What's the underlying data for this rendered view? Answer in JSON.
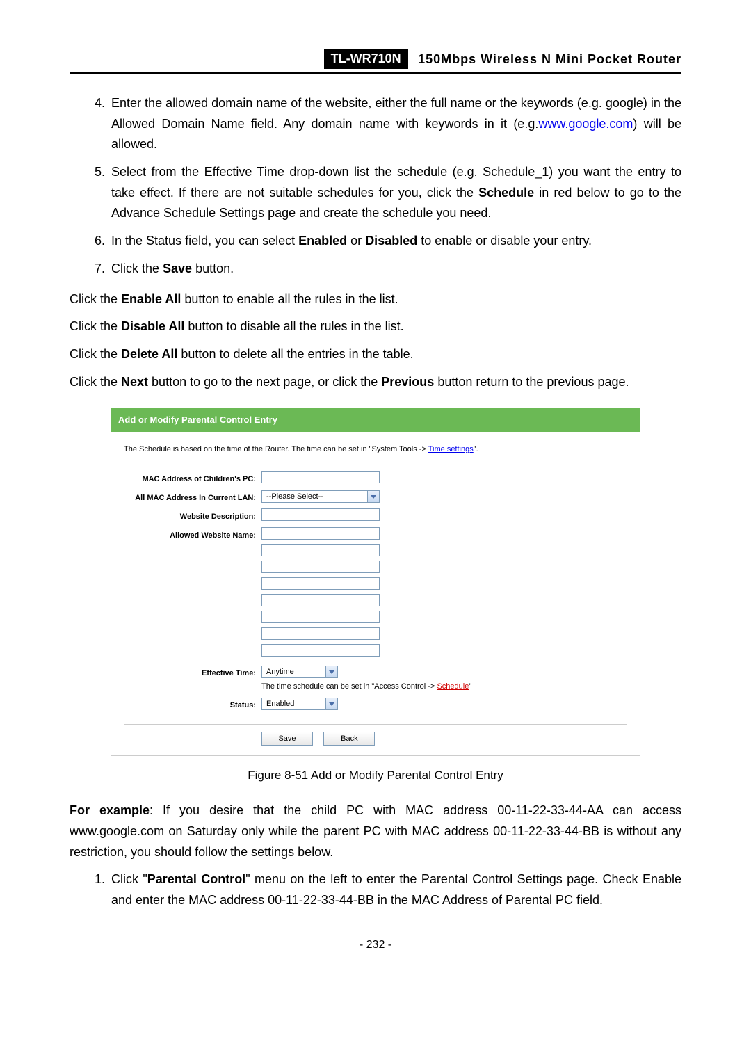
{
  "header": {
    "model": "TL-WR710N",
    "title": "150Mbps  Wireless  N  Mini  Pocket  Router"
  },
  "steps": {
    "s4_a": "Enter the allowed domain name of the website, either the full name or the keywords (e.g. google) in the Allowed Domain Name field. Any domain name with keywords in it (e.g.",
    "s4_link": "www.google.com",
    "s4_b": ") will be allowed.",
    "s5_a": "Select from the Effective Time drop-down list the schedule (e.g. Schedule_1) you want the entry to take effect. If there are not suitable schedules for you, click the ",
    "s5_bold": "Schedule",
    "s5_b": " in red below to go to the Advance Schedule Settings page and create the schedule you need.",
    "s6_a": "In the Status field, you can select ",
    "s6_bold1": "Enabled",
    "s6_mid": " or ",
    "s6_bold2": "Disabled",
    "s6_b": " to enable or disable your entry.",
    "s7_a": "Click the ",
    "s7_bold": "Save",
    "s7_b": " button."
  },
  "paras": {
    "p1_a": "Click the ",
    "p1_bold": "Enable All",
    "p1_b": " button to enable all the rules in the list.",
    "p2_a": "Click the ",
    "p2_bold": "Disable All",
    "p2_b": " button to disable all the rules in the list.",
    "p3_a": "Click the ",
    "p3_bold": "Delete All",
    "p3_b": " button to delete all the entries in the table.",
    "p4_a": "Click the ",
    "p4_bold1": "Next",
    "p4_mid": " button to go to the next page, or click the ",
    "p4_bold2": "Previous",
    "p4_b": " button return to the previous page."
  },
  "figure": {
    "title": "Add or Modify Parental Control Entry",
    "note_a": "The Schedule is based on the time of the Router. The time can be set in \"System Tools -> ",
    "note_link": "Time settings",
    "note_b": "\".",
    "labels": {
      "mac_child": "MAC Address of Children's PC:",
      "all_mac": "All MAC Address In Current LAN:",
      "web_desc": "Website Description:",
      "allowed_name": "Allowed Website Name:",
      "eff_time": "Effective Time:",
      "status": "Status:"
    },
    "values": {
      "please_select": "--Please Select--",
      "anytime": "Anytime",
      "enabled": "Enabled"
    },
    "eff_note_a": "The time schedule can be set in \"Access Control -> ",
    "eff_note_link": "Schedule",
    "eff_note_b": "\"",
    "buttons": {
      "save": "Save",
      "back": "Back"
    },
    "caption": "Figure 8-51    Add or Modify Parental Control Entry"
  },
  "example": {
    "lead_bold": "For example",
    "lead_rest": ": If you desire that the child PC with MAC address 00-11-22-33-44-AA can access www.google.com on Saturday only while the parent PC with MAC address 00-11-22-33-44-BB is without any restriction, you should follow the settings below.",
    "step1_a": "Click \"",
    "step1_bold": "Parental Control",
    "step1_b": "\" menu on the left to enter the Parental Control Settings page. Check Enable and enter the MAC address 00-11-22-33-44-BB in the MAC Address of Parental PC field."
  },
  "page_number": "- 232 -"
}
